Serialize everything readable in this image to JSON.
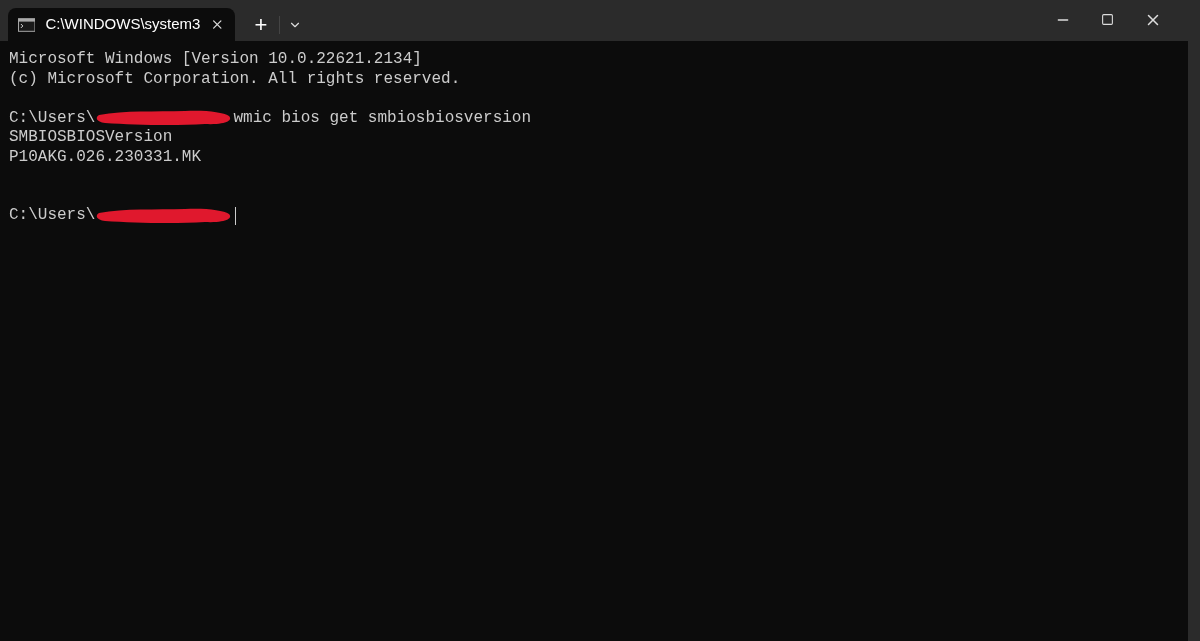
{
  "tabs": [
    {
      "title": "C:\\WINDOWS\\system3",
      "selected": true
    }
  ],
  "new_tab": "+",
  "lines": [
    {
      "kind": "text",
      "text": "Microsoft Windows [Version 10.0.22621.2134]"
    },
    {
      "kind": "text",
      "text": "(c) Microsoft Corporation. All rights reserved."
    },
    {
      "kind": "blank"
    },
    {
      "kind": "prompt",
      "prefix": "C:\\Users\\",
      "suffix": "wmic bios get smbiosbiosversion",
      "cursor": false
    },
    {
      "kind": "text",
      "text": "SMBIOSBIOSVersion"
    },
    {
      "kind": "text",
      "text": "P10AKG.026.230331.MK"
    },
    {
      "kind": "blank"
    },
    {
      "kind": "blank"
    },
    {
      "kind": "prompt",
      "prefix": "C:\\Users\\",
      "cursor": true
    }
  ]
}
